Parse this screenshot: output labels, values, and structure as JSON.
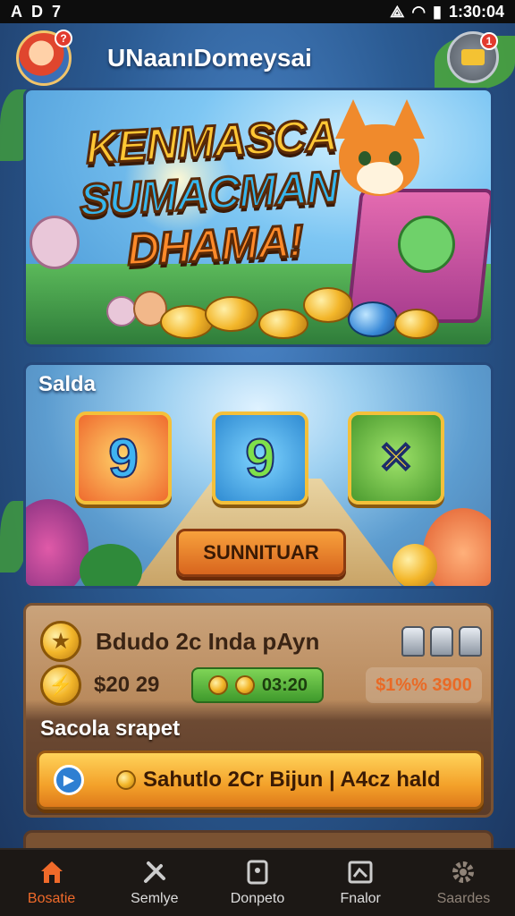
{
  "status_bar": {
    "left": [
      "A",
      "D",
      "7"
    ],
    "time": "1:30:04"
  },
  "header": {
    "title": "UNaanıDomeysai",
    "avatar_badge": "?",
    "mail_badge": "1"
  },
  "banner": {
    "line1": "KENMASCA",
    "line2": "SUMACMAN",
    "line3": "DHAMA!"
  },
  "game_section": {
    "label": "Salda",
    "tiles": [
      "9",
      "9",
      "✕"
    ],
    "play_button": "SUNNITUAR"
  },
  "bonus_panel": {
    "row1_text": "Bdudo 2c Inda pAyn",
    "amount": "$20 29",
    "green_pill": "03:20",
    "right_value": "$1%% 3900",
    "section_label": "Sacola srapet",
    "claim_button": "Sahutlo 2Cr Bijun | A4cz hald"
  },
  "nav": {
    "items": [
      {
        "label": "Bosatie",
        "icon": "home-icon"
      },
      {
        "label": "Semlye",
        "icon": "tools-icon"
      },
      {
        "label": "Donpeto",
        "icon": "card-icon"
      },
      {
        "label": "Fnalor",
        "icon": "frame-icon"
      },
      {
        "label": "Saardes",
        "icon": "gear-icon"
      }
    ]
  },
  "colors": {
    "accent": "#f06a2a",
    "gold": "#f3b62a",
    "panel": "#b98a5d"
  }
}
